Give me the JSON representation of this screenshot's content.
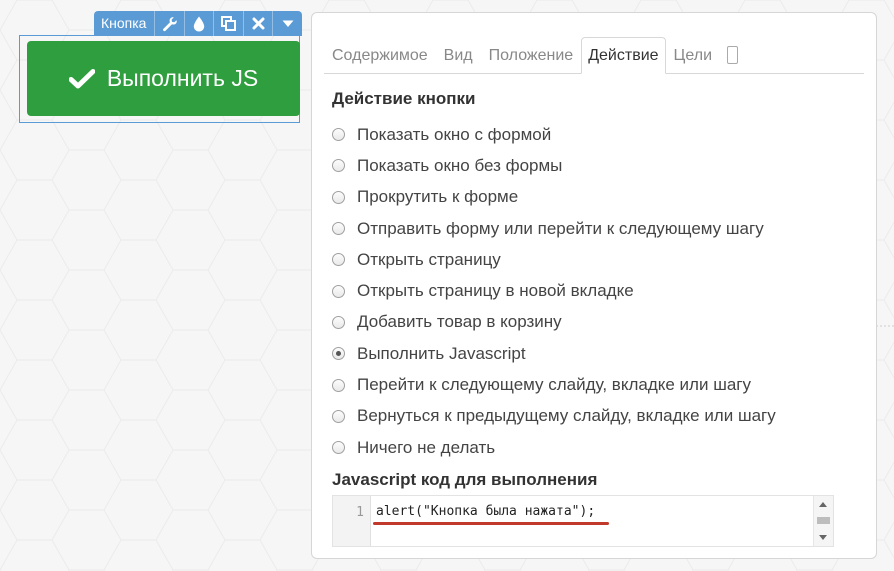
{
  "element_toolbar": {
    "label": "Кнопка",
    "icons": [
      "wrench-icon",
      "drop-icon",
      "duplicate-icon",
      "close-icon",
      "caret-down-icon"
    ]
  },
  "preview_button": {
    "icon": "checkmark-icon",
    "label": "Выполнить JS",
    "color": "#2e9e3e"
  },
  "panel": {
    "tabs": [
      {
        "label": "Содержимое",
        "active": false
      },
      {
        "label": "Вид",
        "active": false
      },
      {
        "label": "Положение",
        "active": false
      },
      {
        "label": "Действие",
        "active": true
      },
      {
        "label": "Цели",
        "active": false
      }
    ],
    "action_section_title": "Действие кнопки",
    "actions": [
      {
        "label": "Показать окно с формой",
        "selected": false
      },
      {
        "label": "Показать окно без формы",
        "selected": false
      },
      {
        "label": "Прокрутить к форме",
        "selected": false
      },
      {
        "label": "Отправить форму или перейти к следующему шагу",
        "selected": false
      },
      {
        "label": "Открыть страницу",
        "selected": false
      },
      {
        "label": "Открыть страницу в новой вкладке",
        "selected": false
      },
      {
        "label": "Добавить товар в корзину",
        "selected": false
      },
      {
        "label": "Выполнить Javascript",
        "selected": true
      },
      {
        "label": "Перейти к следующему слайду, вкладке или шагу",
        "selected": false
      },
      {
        "label": "Вернуться к предыдущему слайду, вкладке или шагу",
        "selected": false
      },
      {
        "label": "Ничего не делать",
        "selected": false
      }
    ],
    "code_section_title": "Javascript код для выполнения",
    "code_editor": {
      "line_number": "1",
      "code": "alert(\"Кнопка была нажата\");",
      "highlight_color": "#c0392b"
    }
  }
}
